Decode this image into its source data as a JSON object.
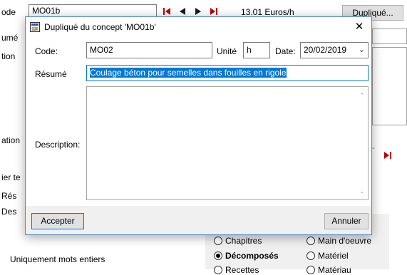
{
  "background": {
    "top_label": "ode",
    "code_value": "MO01b",
    "price": "13.01 Euros/h",
    "duplicate_button": "Dupliqué...",
    "left_labels": [
      "umé",
      "tion",
      "ation",
      "ier te",
      "Rés",
      "Des"
    ],
    "search_option": "Uniquement mots entiers",
    "radios": [
      {
        "label": "Chapitres",
        "checked": false
      },
      {
        "label": "Main d'oeuvre",
        "checked": false
      },
      {
        "label": "Décomposés",
        "checked": true
      },
      {
        "label": "Matériel",
        "checked": false
      },
      {
        "label": "Recettes",
        "checked": false
      },
      {
        "label": "Matériau",
        "checked": false
      }
    ]
  },
  "dialog": {
    "title": "Dupliqué du concept 'MO01b'",
    "close": "✕",
    "code_label": "Code:",
    "code_value": "MO02",
    "unite_label": "Unité",
    "unite_value": "h",
    "date_label": "Date:",
    "date_value": "20/02/2019",
    "resume_label": "Résumé",
    "resume_value": "Coulage béton pour semelles dans fouilles en rigole",
    "description_label": "Description:",
    "description_value": "",
    "accept_button": "Accepter",
    "cancel_button": "Annuler"
  },
  "colors": {
    "accent": "#0078d7",
    "nav_red": "#c00000",
    "footer_bg": "#f0f0f0"
  }
}
